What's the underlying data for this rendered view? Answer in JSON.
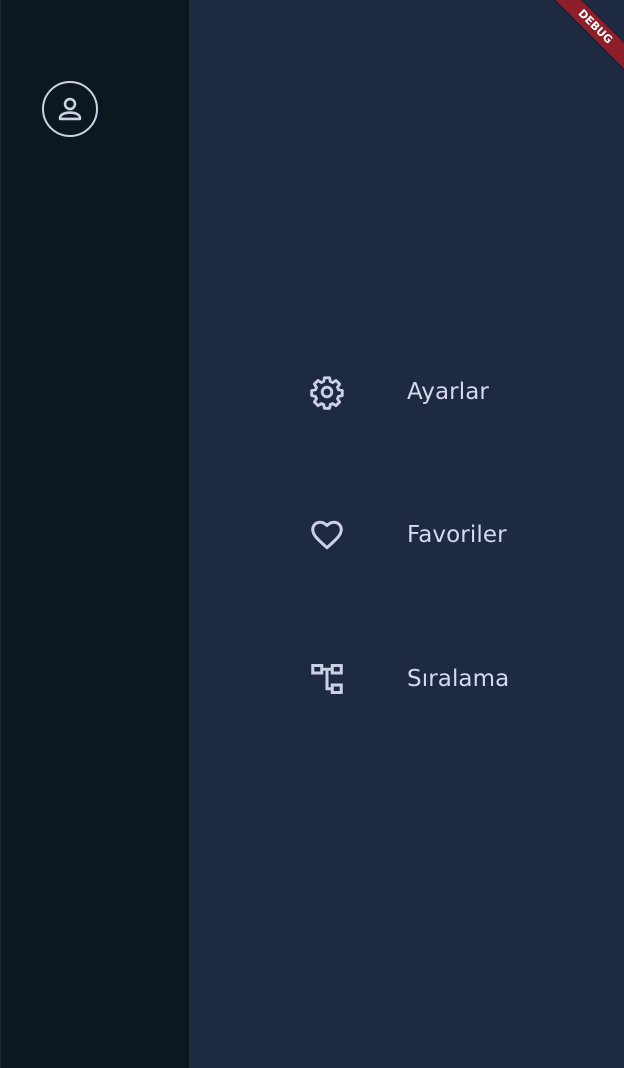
{
  "sidebar": {
    "avatar_icon": "person-outline-icon"
  },
  "menu": {
    "items": [
      {
        "label": "Ayarlar",
        "icon": "gear-icon"
      },
      {
        "label": "Favoriler",
        "icon": "heart-icon"
      },
      {
        "label": "Sıralama",
        "icon": "account-tree-icon"
      }
    ]
  },
  "debug_banner": {
    "label": "DEBUG"
  },
  "colors": {
    "background": "#1d2a42",
    "sidebar": "#0c1720",
    "text": "#d6d9ec",
    "icon": "#cdd1e6",
    "banner": "#8e1e2a"
  }
}
